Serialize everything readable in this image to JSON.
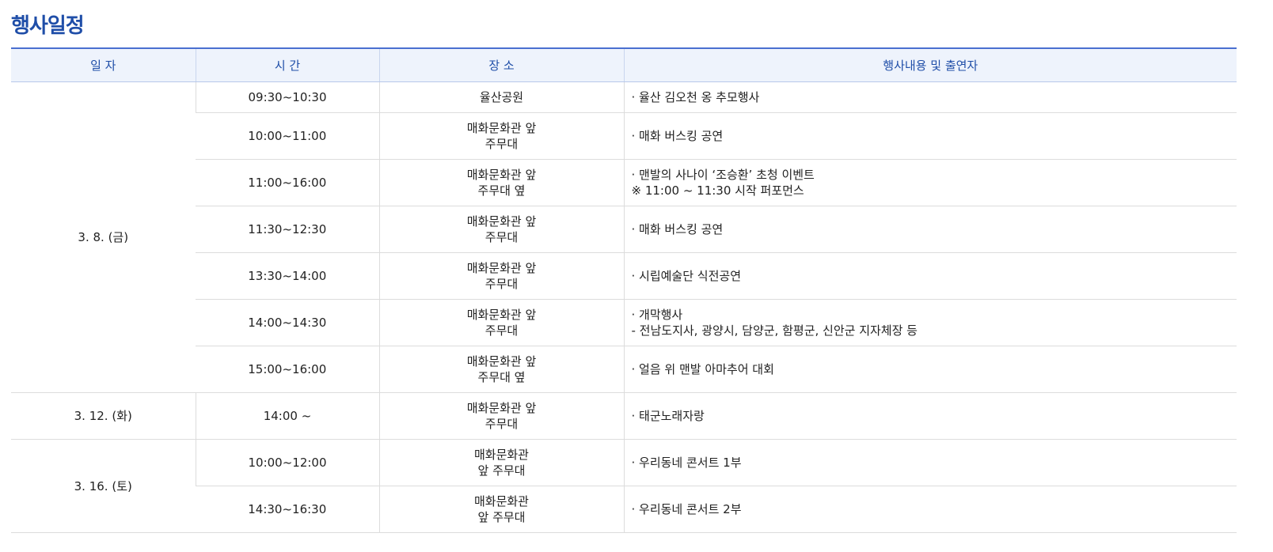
{
  "title": "행사일정",
  "table": {
    "headers": [
      "일 자",
      "시 간",
      "장 소",
      "행사내용 및 출연자"
    ],
    "dates": [
      "3. 8. (금)",
      "3. 12. (화)",
      "3. 16. (토)"
    ],
    "rows": [
      {
        "time": "09:30~10:30",
        "place": [
          "율산공원"
        ],
        "content": [
          "· 율산 김오천 옹 추모행사"
        ]
      },
      {
        "time": "10:00~11:00",
        "place": [
          "매화문화관 앞",
          "주무대"
        ],
        "content": [
          "· 매화 버스킹 공연"
        ]
      },
      {
        "time": "11:00~16:00",
        "place": [
          "매화문화관 앞",
          "주무대 옆"
        ],
        "content": [
          "· 맨발의 사나이 ‘조승환’ 초청 이벤트",
          "※ 11:00 ~ 11:30 시작 퍼포먼스"
        ]
      },
      {
        "time": "11:30~12:30",
        "place": [
          "매화문화관 앞",
          "주무대"
        ],
        "content": [
          "· 매화 버스킹 공연"
        ]
      },
      {
        "time": "13:30~14:00",
        "place": [
          "매화문화관 앞",
          "주무대"
        ],
        "content": [
          "· 시립예술단 식전공연"
        ]
      },
      {
        "time": "14:00~14:30",
        "place": [
          "매화문화관 앞",
          "주무대"
        ],
        "content": [
          "· 개막행사",
          "- 전남도지사, 광양시, 담양군, 함평군, 신안군 지자체장 등"
        ]
      },
      {
        "time": "15:00~16:00",
        "place": [
          "매화문화관 앞",
          "주무대 옆"
        ],
        "content": [
          "· 얼음 위 맨발 아마추어 대회"
        ]
      },
      {
        "time": "14:00 ~",
        "place": [
          "매화문화관 앞",
          "주무대"
        ],
        "content": [
          "· 태군노래자랑"
        ]
      },
      {
        "time": "10:00~12:00",
        "place": [
          "매화문화관",
          "앞 주무대"
        ],
        "content": [
          "· 우리동네 콘서트 1부"
        ]
      },
      {
        "time": "14:30~16:30",
        "place": [
          "매화문화관",
          "앞 주무대"
        ],
        "content": [
          "· 우리동네 콘서트 2부"
        ]
      }
    ]
  },
  "colors": {
    "title": "#1f4ea8",
    "header_bg": "#eef3fc",
    "header_text": "#1f4ea8",
    "top_border": "#4a6fd0"
  }
}
